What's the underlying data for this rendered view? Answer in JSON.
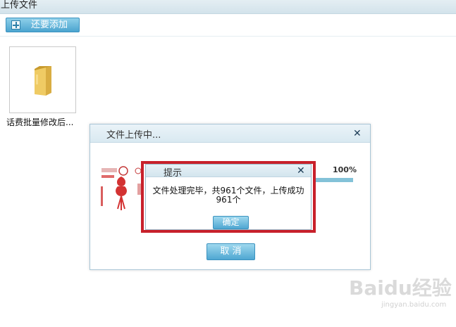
{
  "page": {
    "title": "上传文件"
  },
  "toolbar": {
    "add_more_label": "还要添加"
  },
  "files": [
    {
      "name": "话费批量修改后..."
    }
  ],
  "upload_dialog": {
    "title": "文件上传中...",
    "progress_percent": 100,
    "progress_label": "100%",
    "cancel_label": "取 消"
  },
  "tip_dialog": {
    "title": "提示",
    "message": "文件处理完毕，共961个文件，上传成功961个",
    "ok_label": "确定"
  },
  "watermark": {
    "logo": "Baidu经验",
    "sub": "jingyan.baidu.com"
  },
  "colors": {
    "highlight": "#c8212b",
    "button": "#4fa7d2",
    "folder": "#e9c25a"
  },
  "icons": [
    "add-icon",
    "folder-icon",
    "close-icon"
  ]
}
